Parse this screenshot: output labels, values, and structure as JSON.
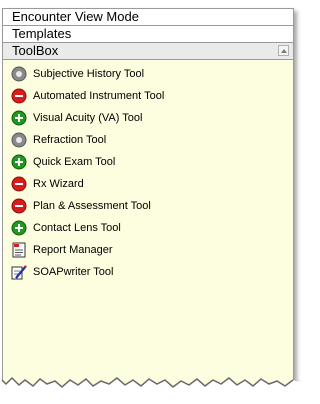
{
  "sections": {
    "encounter_view_mode": "Encounter View Mode",
    "templates": "Templates",
    "toolbox": "ToolBox"
  },
  "tools": [
    {
      "label": "Subjective History Tool",
      "icon": "gray-circle-icon"
    },
    {
      "label": "Automated Instrument Tool",
      "icon": "red-minus-icon"
    },
    {
      "label": "Visual Acuity (VA) Tool",
      "icon": "green-plus-icon"
    },
    {
      "label": "Refraction Tool",
      "icon": "gray-circle-icon"
    },
    {
      "label": "Quick Exam Tool",
      "icon": "green-plus-icon"
    },
    {
      "label": "Rx Wizard",
      "icon": "red-minus-icon"
    },
    {
      "label": "Plan & Assessment Tool",
      "icon": "red-minus-icon"
    },
    {
      "label": "Contact Lens Tool",
      "icon": "green-plus-icon"
    },
    {
      "label": "Report Manager",
      "icon": "report-icon"
    },
    {
      "label": "SOAPwriter Tool",
      "icon": "soapwriter-icon"
    }
  ],
  "colors": {
    "panel_background": "#fdfde0",
    "red_icon": "#d81c1c",
    "green_icon": "#1f9a1f",
    "gray_icon": "#8a8a8a"
  }
}
